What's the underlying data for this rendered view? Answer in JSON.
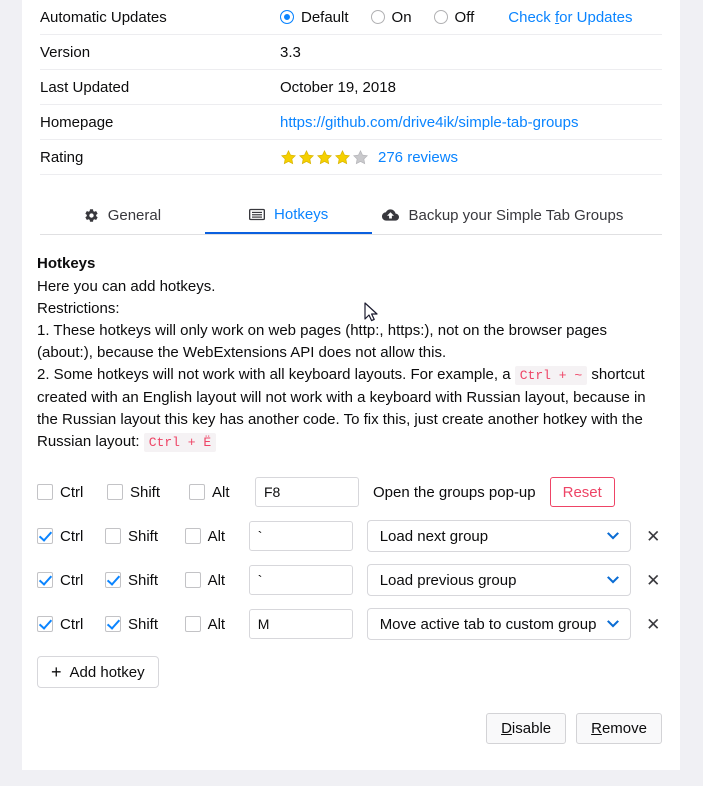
{
  "details": {
    "rows": [
      {
        "label": "Automatic Updates",
        "type": "radio"
      },
      {
        "label": "Version",
        "value": "3.3",
        "type": "text"
      },
      {
        "label": "Last Updated",
        "value": "October 19, 2018",
        "type": "text"
      },
      {
        "label": "Homepage",
        "value": "https://github.com/drive4ik/simple-tab-groups",
        "type": "link"
      },
      {
        "label": "Rating",
        "type": "rating"
      }
    ],
    "updates": {
      "options": [
        {
          "label": "Default",
          "selected": true
        },
        {
          "label": "On",
          "selected": false
        },
        {
          "label": "Off",
          "selected": false
        }
      ],
      "check_link": "Check for Updates",
      "check_link_accesskey": "f"
    },
    "rating": {
      "filled_stars": 4,
      "total_stars": 5,
      "reviews_label": "276 reviews",
      "star_color": "#f5d000",
      "star_empty_color": "#c9c9cc"
    }
  },
  "tabs": [
    {
      "label": "General",
      "icon": "gear-icon",
      "active": false
    },
    {
      "label": "Hotkeys",
      "icon": "keyboard-icon",
      "active": true
    },
    {
      "label": "Backup your Simple Tab Groups",
      "icon": "cloud-upload-icon",
      "active": false
    }
  ],
  "panel": {
    "title": "Hotkeys",
    "intro": "Here you can add hotkeys.",
    "restrictions_label": "Restrictions:",
    "rule1": "1. These hotkeys will only work on web pages (http:, https:), not on the browser pages (about:), because the WebExtensions API does not allow this.",
    "rule2_part1": "2. Some hotkeys will not work with all keyboard layouts. For example, a",
    "rule2_code1": "Ctrl + ~",
    "rule2_part2": "shortcut created with an English layout will not work with a keyboard with Russian layout, because in the Russian layout this key has another code. To fix this, just create another hotkey with the Russian layout:",
    "rule2_code2": "Ctrl + Ë"
  },
  "modifier_labels": {
    "ctrl": "Ctrl",
    "shift": "Shift",
    "alt": "Alt"
  },
  "hotkeys": [
    {
      "ctrl": false,
      "shift": false,
      "alt": false,
      "key": "F8",
      "action": "Open the groups pop-up",
      "action_is_select": false,
      "reset_label": "Reset",
      "removable": false
    },
    {
      "ctrl": true,
      "shift": false,
      "alt": false,
      "key": "`",
      "action": "Load next group",
      "action_is_select": true,
      "removable": true
    },
    {
      "ctrl": true,
      "shift": true,
      "alt": false,
      "key": "`",
      "action": "Load previous group",
      "action_is_select": true,
      "removable": true
    },
    {
      "ctrl": true,
      "shift": true,
      "alt": false,
      "key": "M",
      "action": "Move active tab to custom group",
      "action_is_select": true,
      "removable": true
    }
  ],
  "add_hotkey_label": "Add hotkey",
  "footer": {
    "disable_label": "Disable",
    "disable_accesskey": "D",
    "remove_label": "Remove",
    "remove_accesskey": "R"
  },
  "colors": {
    "accent_blue": "#0a84ff",
    "accent_red": "#ee4466",
    "star_gold": "#f5d000"
  }
}
